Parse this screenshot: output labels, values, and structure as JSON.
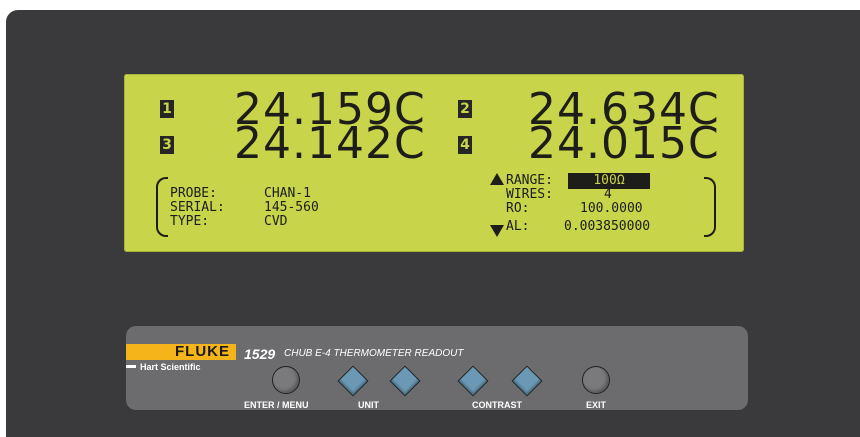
{
  "display": {
    "channels": [
      {
        "num": "1",
        "reading": "24.159C"
      },
      {
        "num": "2",
        "reading": "24.634C"
      },
      {
        "num": "3",
        "reading": "24.142C"
      },
      {
        "num": "4",
        "reading": "24.015C"
      }
    ],
    "probe_label": "PROBE:",
    "probe_value": "CHAN-1",
    "serial_label": "SERIAL:",
    "serial_value": "145-560",
    "type_label": "TYPE:",
    "type_value": "CVD",
    "range_label": "RANGE:",
    "range_value": "100Ω",
    "wires_label": "WIRES:",
    "wires_value": "4",
    "r0_label": "RO:",
    "r0_value": "100.0000",
    "al_label": "AL:",
    "al_value": "0.003850000"
  },
  "panel": {
    "brand": "FLUKE",
    "sub_brand": "Hart Scientific",
    "model": "1529",
    "description": "CHUB E-4 THERMOMETER READOUT",
    "enter_menu_label": "ENTER / MENU",
    "unit_label": "UNIT",
    "contrast_label": "CONTRAST",
    "exit_label": "EXIT"
  },
  "colors": {
    "lcd_background": "#c8d44a",
    "body": "#3a3a3c",
    "panel": "#6c6c6e",
    "brand_yellow": "#f4b41a",
    "diamond_button": "#6b98b4"
  }
}
